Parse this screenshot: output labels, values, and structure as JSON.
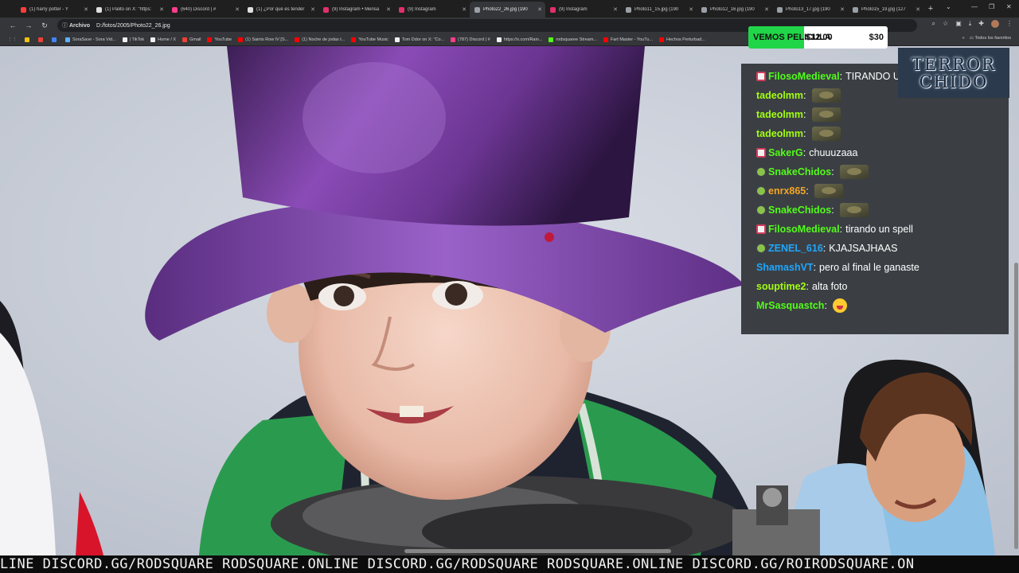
{
  "browser": {
    "tabs": [
      {
        "title": "(1) harry potter - Y",
        "favicon_color": "#ff3d3d",
        "active": false
      },
      {
        "title": "(1) Palito on X: \"https:",
        "favicon_color": "#e0e0e0",
        "active": false
      },
      {
        "title": "(640) Discord | #",
        "favicon_color": "#ff3d8b",
        "active": false
      },
      {
        "title": "(1) ¿Por qué es tender",
        "favicon_color": "#e0e0e0",
        "active": false
      },
      {
        "title": "(9) Instagram • Mensa",
        "favicon_color": "#e1306c",
        "active": false
      },
      {
        "title": "(9) Instagram",
        "favicon_color": "#e1306c",
        "active": false
      },
      {
        "title": "Photo22_26.jpg (190",
        "favicon_color": "#9aa0a6",
        "active": true
      },
      {
        "title": "(9) Instagram",
        "favicon_color": "#e1306c",
        "active": false
      },
      {
        "title": "Photo11_15.jpg (190",
        "favicon_color": "#9aa0a6",
        "active": false
      },
      {
        "title": "Photo12_16.jpg (190",
        "favicon_color": "#9aa0a6",
        "active": false
      },
      {
        "title": "Photo13_17.jpg (190",
        "favicon_color": "#9aa0a6",
        "active": false
      },
      {
        "title": "Photo15_19.jpg (127",
        "favicon_color": "#9aa0a6",
        "active": false
      }
    ],
    "new_tab": "+",
    "address_chip": "Archivo",
    "address": "D:/fotos/2005/Photo22_26.jpg",
    "bookmarks": [
      {
        "label": "",
        "color": "#f4c20d"
      },
      {
        "label": "",
        "color": "#ea4335"
      },
      {
        "label": "",
        "color": "#4285f4"
      },
      {
        "label": "SoraSave - Sora Vid...",
        "color": "#5fb0ff"
      },
      {
        "label": "| TikTok",
        "color": "#f0f0f0"
      },
      {
        "label": "Home / X",
        "color": "#f0f0f0"
      },
      {
        "label": "Gmail",
        "color": "#ea4335"
      },
      {
        "label": "YouTube",
        "color": "#ff0000"
      },
      {
        "label": "(1) Saints Row IV [S...",
        "color": "#ff0000"
      },
      {
        "label": "(1) Noche de jodas t...",
        "color": "#ff0000"
      },
      {
        "label": "YouTube Music",
        "color": "#ff0000"
      },
      {
        "label": "Tom Ddor on X: \"Co...",
        "color": "#f0f0f0"
      },
      {
        "label": "(787) Discord | #",
        "color": "#ff3d8b"
      },
      {
        "label": "https://x.com/Rain...",
        "color": "#f0f0f0"
      },
      {
        "label": "rodsquaree Stream...",
        "color": "#53fc18"
      },
      {
        "label": "Fart Master - YouTu...",
        "color": "#ff0000"
      },
      {
        "label": "Hechos Perturbad...",
        "color": "#ff0000"
      }
    ],
    "bookmarks_more": "»",
    "all_bookmarks": "Todos los favoritos"
  },
  "goal": {
    "label": "VEMOS PELICULA",
    "current": "$12.00",
    "target": "$30",
    "progress": 0.4
  },
  "logo": {
    "line1": "TERROR",
    "line2": "CHIDO"
  },
  "chat": {
    "colors": {
      "green": "#53fc18",
      "blue": "#1ea7ff",
      "orange": "#f5a623",
      "lime": "#a3ff12",
      "white": "#ffffff"
    },
    "messages": [
      {
        "badge": "sub",
        "user": "FilosoMedieval",
        "color": "#53fc18",
        "text": "TIRANDO U",
        "emote": ""
      },
      {
        "badge": "",
        "user": "tadeolmm",
        "color": "#a3ff12",
        "text": "",
        "emote": "frog"
      },
      {
        "badge": "",
        "user": "tadeolmm",
        "color": "#a3ff12",
        "text": "",
        "emote": "frog"
      },
      {
        "badge": "",
        "user": "tadeolmm",
        "color": "#a3ff12",
        "text": "",
        "emote": "frog"
      },
      {
        "badge": "sub",
        "user": "SakerG",
        "color": "#53fc18",
        "text": "chuuuzaaa",
        "emote": ""
      },
      {
        "badge": "smile",
        "user": "SnakeChidos",
        "color": "#53fc18",
        "text": "",
        "emote": "frog"
      },
      {
        "badge": "smile",
        "user": "enrx865",
        "color": "#f5a623",
        "text": "",
        "emote": "frog"
      },
      {
        "badge": "smile",
        "user": "SnakeChidos",
        "color": "#53fc18",
        "text": "",
        "emote": "frog"
      },
      {
        "badge": "sub",
        "user": "FilosoMedieval",
        "color": "#53fc18",
        "text": "tirando un spell",
        "emote": ""
      },
      {
        "badge": "smile",
        "user": "ZENEL_616",
        "color": "#1ea7ff",
        "text": "KJAJSAJHAAS",
        "emote": ""
      },
      {
        "badge": "",
        "user": "ShamashVT",
        "color": "#1ea7ff",
        "text": "pero al final le ganaste",
        "emote": ""
      },
      {
        "badge": "",
        "user": "souptime2",
        "color": "#a3ff12",
        "text": "alta foto",
        "emote": ""
      },
      {
        "badge": "",
        "user": "MrSasquastch",
        "color": "#53fc18",
        "text": "",
        "emote": "face"
      }
    ]
  },
  "ticker": {
    "text": "LINE DISCORD.GG/RODSQUARE RODSQUARE.ONLINE DISCORD.GG/RODSQUARE RODSQUARE.ONLINE DISCORD.GG/ROIRODSQUARE.ON"
  }
}
